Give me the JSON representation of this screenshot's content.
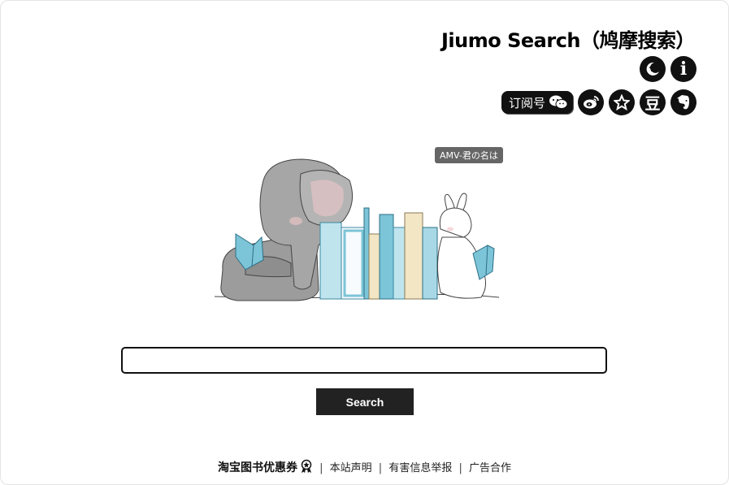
{
  "header": {
    "title": "Jiumo Search（鸠摩搜索）",
    "icons_top": [
      "moon-icon",
      "info-icon"
    ],
    "subscribe_label": "订阅号",
    "icons_bottom": [
      "wechat-icon",
      "weibo-icon",
      "star-icon",
      "douban-icon",
      "evernote-icon"
    ],
    "douban_glyph": "豆",
    "info_glyph": "i"
  },
  "tooltip": {
    "text": "AMV-君の名は"
  },
  "search": {
    "value": "",
    "placeholder": "",
    "button_label": "Search"
  },
  "footer": {
    "promo_link": "淘宝图书优惠券",
    "links": [
      "本站声明",
      "有害信息举报",
      "广告合作"
    ],
    "separator": "|"
  },
  "colors": {
    "accent": "#111111",
    "book_blue": "#7cc4d8",
    "book_cream": "#f3e6c4",
    "elephant": "#9a9a9a"
  }
}
